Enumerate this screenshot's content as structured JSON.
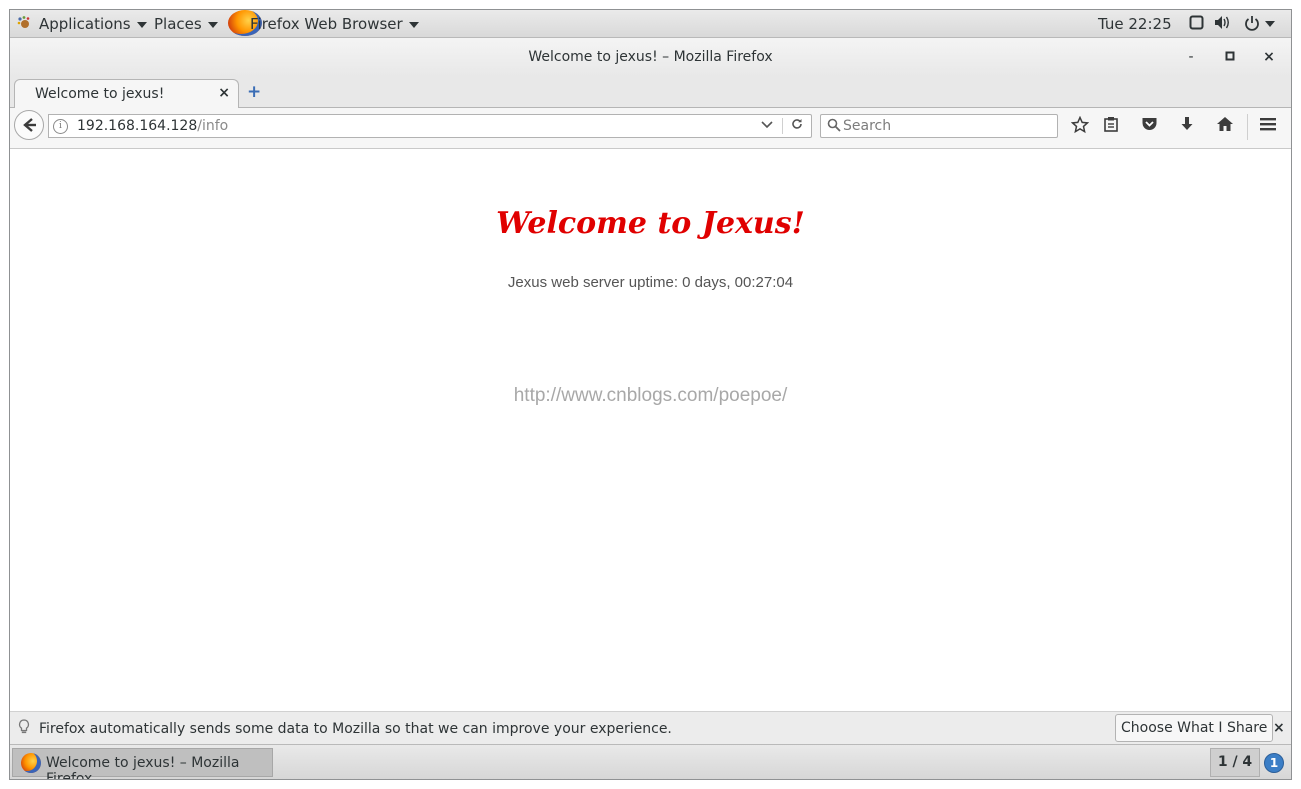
{
  "topbar": {
    "applications_label": "Applications",
    "places_label": "Places",
    "app_menu_label": "Firefox Web Browser",
    "clock": "Tue 22:25"
  },
  "window": {
    "title": "Welcome to jexus! – Mozilla Firefox",
    "minimize": "-",
    "maximize": "□",
    "close": "×"
  },
  "tabs": [
    {
      "label": "Welcome to jexus!",
      "close": "×"
    }
  ],
  "newtab_symbol": "+",
  "address": {
    "host": "192.168.164.128",
    "path": "/info"
  },
  "search": {
    "placeholder": "Search"
  },
  "page": {
    "heading": "Welcome to Jexus!",
    "uptime": "Jexus web server uptime: 0 days, 00:27:04",
    "link": "http://www.cnblogs.com/poepoe/"
  },
  "notification": {
    "message": "Firefox automatically sends some data to Mozilla so that we can improve your experience.",
    "button_label": "Choose What I Share",
    "close": "×"
  },
  "taskbar": {
    "window_label": "Welcome to jexus! – Mozilla Firefox",
    "workspace": "1 / 4",
    "notification_count": "1"
  },
  "colors": {
    "heading": "#e00000",
    "uptime_text": "#555555",
    "link_text": "#a8a8a8",
    "notification_badge": "#3b7ec6"
  },
  "icons": {
    "activities": "gnome-foot-icon",
    "app_icon": "firefox-icon",
    "screen": "screen-icon",
    "volume": "volume-icon",
    "power": "power-icon",
    "back": "back-arrow-icon",
    "info": "info-icon",
    "reload": "reload-icon",
    "search": "search-icon",
    "bookmark": "star-icon",
    "reader": "clipboard-icon",
    "pocket": "pocket-icon",
    "download": "download-icon",
    "home": "home-icon",
    "menu": "hamburger-menu-icon",
    "bulb": "lightbulb-icon"
  }
}
